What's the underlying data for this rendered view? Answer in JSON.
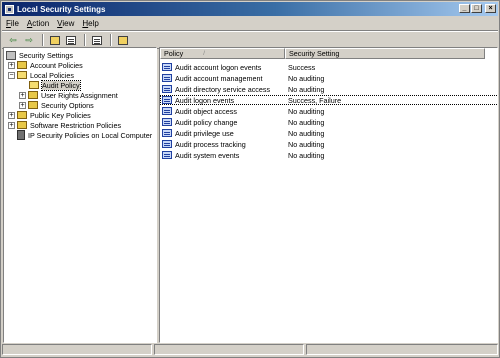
{
  "window": {
    "title": "Local Security Settings",
    "controls": {
      "minimize": "_",
      "maximize": "□",
      "close": "×"
    }
  },
  "menu": {
    "items": [
      {
        "accel": "F",
        "rest": "ile"
      },
      {
        "accel": "A",
        "rest": "ction"
      },
      {
        "accel": "V",
        "rest": "iew"
      },
      {
        "accel": "H",
        "rest": "elp"
      }
    ]
  },
  "toolbar": {
    "icons": [
      "back-arrow-icon",
      "forward-arrow-icon",
      "up-folder-icon",
      "show-tree-icon",
      "export-list-icon",
      "properties-icon"
    ],
    "back_glyph": "⇦",
    "forward_glyph": "⇨"
  },
  "tree": {
    "root": "Security Settings",
    "items": [
      {
        "label": "Account Policies",
        "expander": "+"
      },
      {
        "label": "Local Policies",
        "expander": "−"
      },
      {
        "label": "Audit Policy",
        "selected": true
      },
      {
        "label": "User Rights Assignment",
        "expander": "+"
      },
      {
        "label": "Security Options",
        "expander": "+"
      },
      {
        "label": "Public Key Policies",
        "expander": "+"
      },
      {
        "label": "Software Restriction Policies",
        "expander": "+"
      },
      {
        "label": "IP Security Policies on Local Computer"
      }
    ]
  },
  "list": {
    "columns": {
      "policy": "Policy",
      "setting": "Security Setting",
      "sort_glyph": "/"
    },
    "rows": [
      {
        "policy": "Audit account logon events",
        "setting": "Success"
      },
      {
        "policy": "Audit account management",
        "setting": "No auditing"
      },
      {
        "policy": "Audit directory service access",
        "setting": "No auditing"
      },
      {
        "policy": "Audit logon events",
        "setting": "Success, Failure",
        "focused": true
      },
      {
        "policy": "Audit object access",
        "setting": "No auditing"
      },
      {
        "policy": "Audit policy change",
        "setting": "No auditing"
      },
      {
        "policy": "Audit privilege use",
        "setting": "No auditing"
      },
      {
        "policy": "Audit process tracking",
        "setting": "No auditing"
      },
      {
        "policy": "Audit system events",
        "setting": "No auditing"
      }
    ]
  },
  "colors": {
    "titlebar_start": "#0a246a",
    "titlebar_end": "#a6caf0",
    "chrome": "#d4d0c8",
    "pane_background": "#ffffff"
  }
}
